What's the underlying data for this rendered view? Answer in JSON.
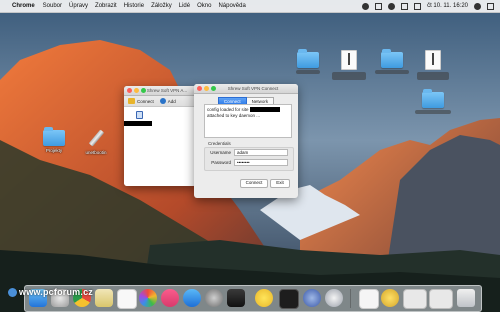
{
  "menubar": {
    "app_name": "Chrome",
    "items": [
      "Soubor",
      "Úpravy",
      "Zobrazit",
      "Historie",
      "Záložky",
      "Lidé",
      "Okno",
      "Nápověda"
    ],
    "clock": "čt 10. 11.  16:20"
  },
  "desktop_icons": {
    "projekty": "Projekty",
    "unetbootin": "unetbootin",
    "top_folder_1": "",
    "top_file_1": "",
    "top_folder_2": "",
    "top_file_2": "",
    "right_folder": "",
    "right_folder_label": "",
    "label_note": "Desktop item labels are blurred/illegible in the screenshot"
  },
  "main_window": {
    "title": "Shrew Soft VPN A...",
    "toolbar": {
      "connect_label": "Connect",
      "add_label": "Add"
    }
  },
  "connect_dialog": {
    "title": "Shrew Soft VPN Connect",
    "tabs": [
      "Connect",
      "Network"
    ],
    "active_tab": 0,
    "log_lines": [
      "config loaded for site",
      "attached to key daemon ..."
    ],
    "credentials_label": "Credentials",
    "username_label": "Username",
    "username_value": "adam",
    "password_label": "Password",
    "password_value": "••••••••",
    "connect_button": "Connect",
    "exit_button": "Exit"
  },
  "watermark": {
    "text": "www.pcforum.cz"
  },
  "colors": {
    "accent_blue": "#2a78e8",
    "menubar_bg": "#f5f5f5",
    "window_bg": "#ececec"
  }
}
